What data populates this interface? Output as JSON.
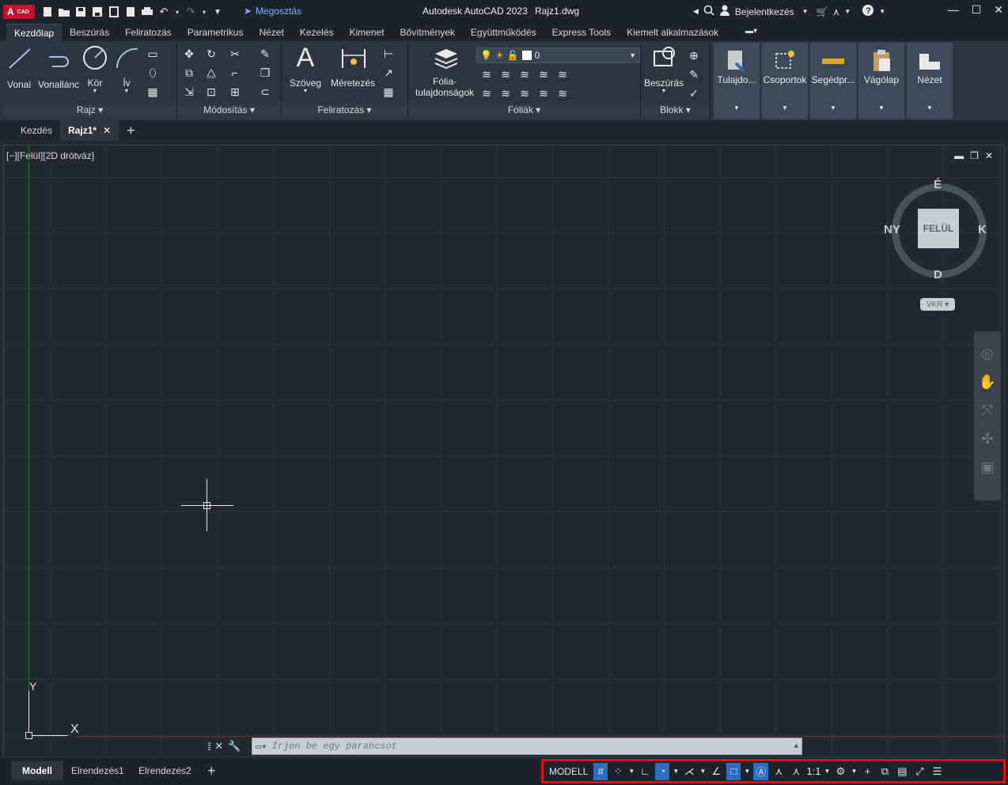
{
  "titlebar": {
    "logo_a": "A",
    "logo_cad": "CAD",
    "share": "Megosztás",
    "app_title": "Autodesk AutoCAD 2023",
    "file_name": "Rajz1.dwg",
    "signin": "Bejelentkezés"
  },
  "ribbon_tabs": [
    "Kezdőlap",
    "Beszúrás",
    "Feliratozás",
    "Parametrikus",
    "Nézet",
    "Kezelés",
    "Kimenet",
    "Bővítmények",
    "Együttműködés",
    "Express Tools",
    "Kiemelt alkalmazások"
  ],
  "ribbon": {
    "draw": {
      "title": "Rajz",
      "vonal": "Vonal",
      "vonallanc": "Vonallánc",
      "kor": "Kör",
      "iv": "Ív"
    },
    "modify": {
      "title": "Módosítás"
    },
    "annotate": {
      "title": "Feliratozás",
      "szoveg": "Szöveg",
      "meretezes": "Méretezés"
    },
    "layers": {
      "title": "Fóliák",
      "props_line1": "Fólia-",
      "props_line2": "tulajdonságok",
      "current_layer": "0"
    },
    "block": {
      "title": "Blokk",
      "beszuras": "Beszúrás"
    },
    "tiles": [
      "Tulajdo...",
      "Csoportok",
      "Segédpr...",
      "Vágólap",
      "Nézet"
    ]
  },
  "doc_tabs": {
    "start": "Kezdés",
    "drawing": "Rajz1*"
  },
  "viewport": {
    "label": "[−][Felül][2D drótváz]",
    "viewcube": {
      "face": "FELÜL",
      "north": "É",
      "south": "D",
      "east": "K",
      "west": "NY",
      "ucs_button": "VKR"
    }
  },
  "ucs": {
    "x_label": "X",
    "y_label": "Y"
  },
  "command": {
    "placeholder": "Írjon be egy parancsot"
  },
  "layout_tabs": [
    "Modell",
    "Elrendezés1",
    "Elrendezés2"
  ],
  "statusbar": {
    "model": "MODELL",
    "scale": "1:1"
  }
}
